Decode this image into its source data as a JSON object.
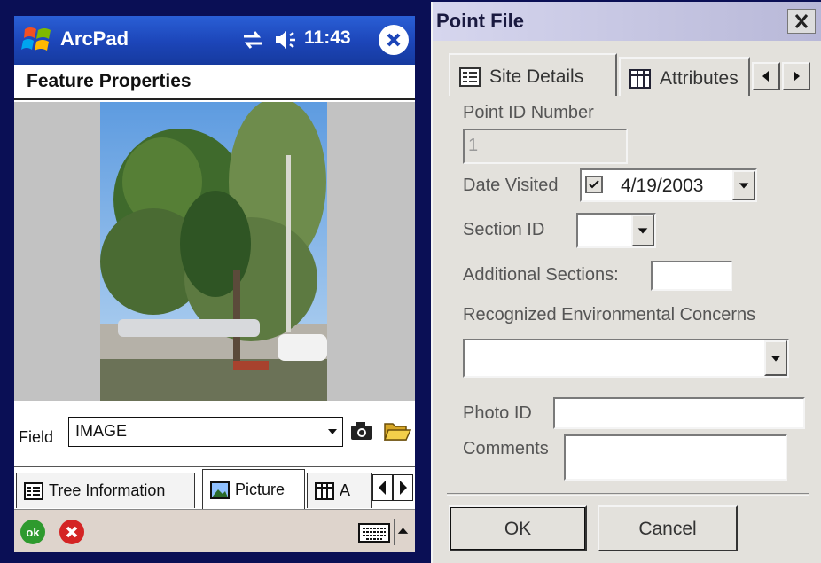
{
  "device": {
    "app_title": "ArcPad",
    "clock": "11:43",
    "page_title": "Feature Properties",
    "field_label": "Field",
    "field_value": "IMAGE",
    "tabs": [
      {
        "label": "Tree Information",
        "icon": "form-icon"
      },
      {
        "label": "Picture",
        "icon": "picture-icon"
      },
      {
        "label": "A",
        "icon": "table-icon"
      }
    ],
    "ok_label": "ok"
  },
  "dialog": {
    "title": "Point File",
    "tabs": [
      {
        "label": "Site Details",
        "icon": "form-icon"
      },
      {
        "label": "Attributes",
        "icon": "table-icon"
      }
    ],
    "point_id_label": "Point ID Number",
    "point_id_value": "1",
    "date_label": "Date Visited",
    "date_value": "4/19/2003",
    "section_label": "Section ID",
    "section_value": "",
    "additional_label": "Additional Sections:",
    "additional_value": "",
    "rec_label": "Recognized Environmental Concerns",
    "rec_value": "",
    "photo_label": "Photo ID",
    "photo_value": "",
    "comments_label": "Comments",
    "comments_value": "",
    "ok_label": "OK",
    "cancel_label": "Cancel"
  }
}
